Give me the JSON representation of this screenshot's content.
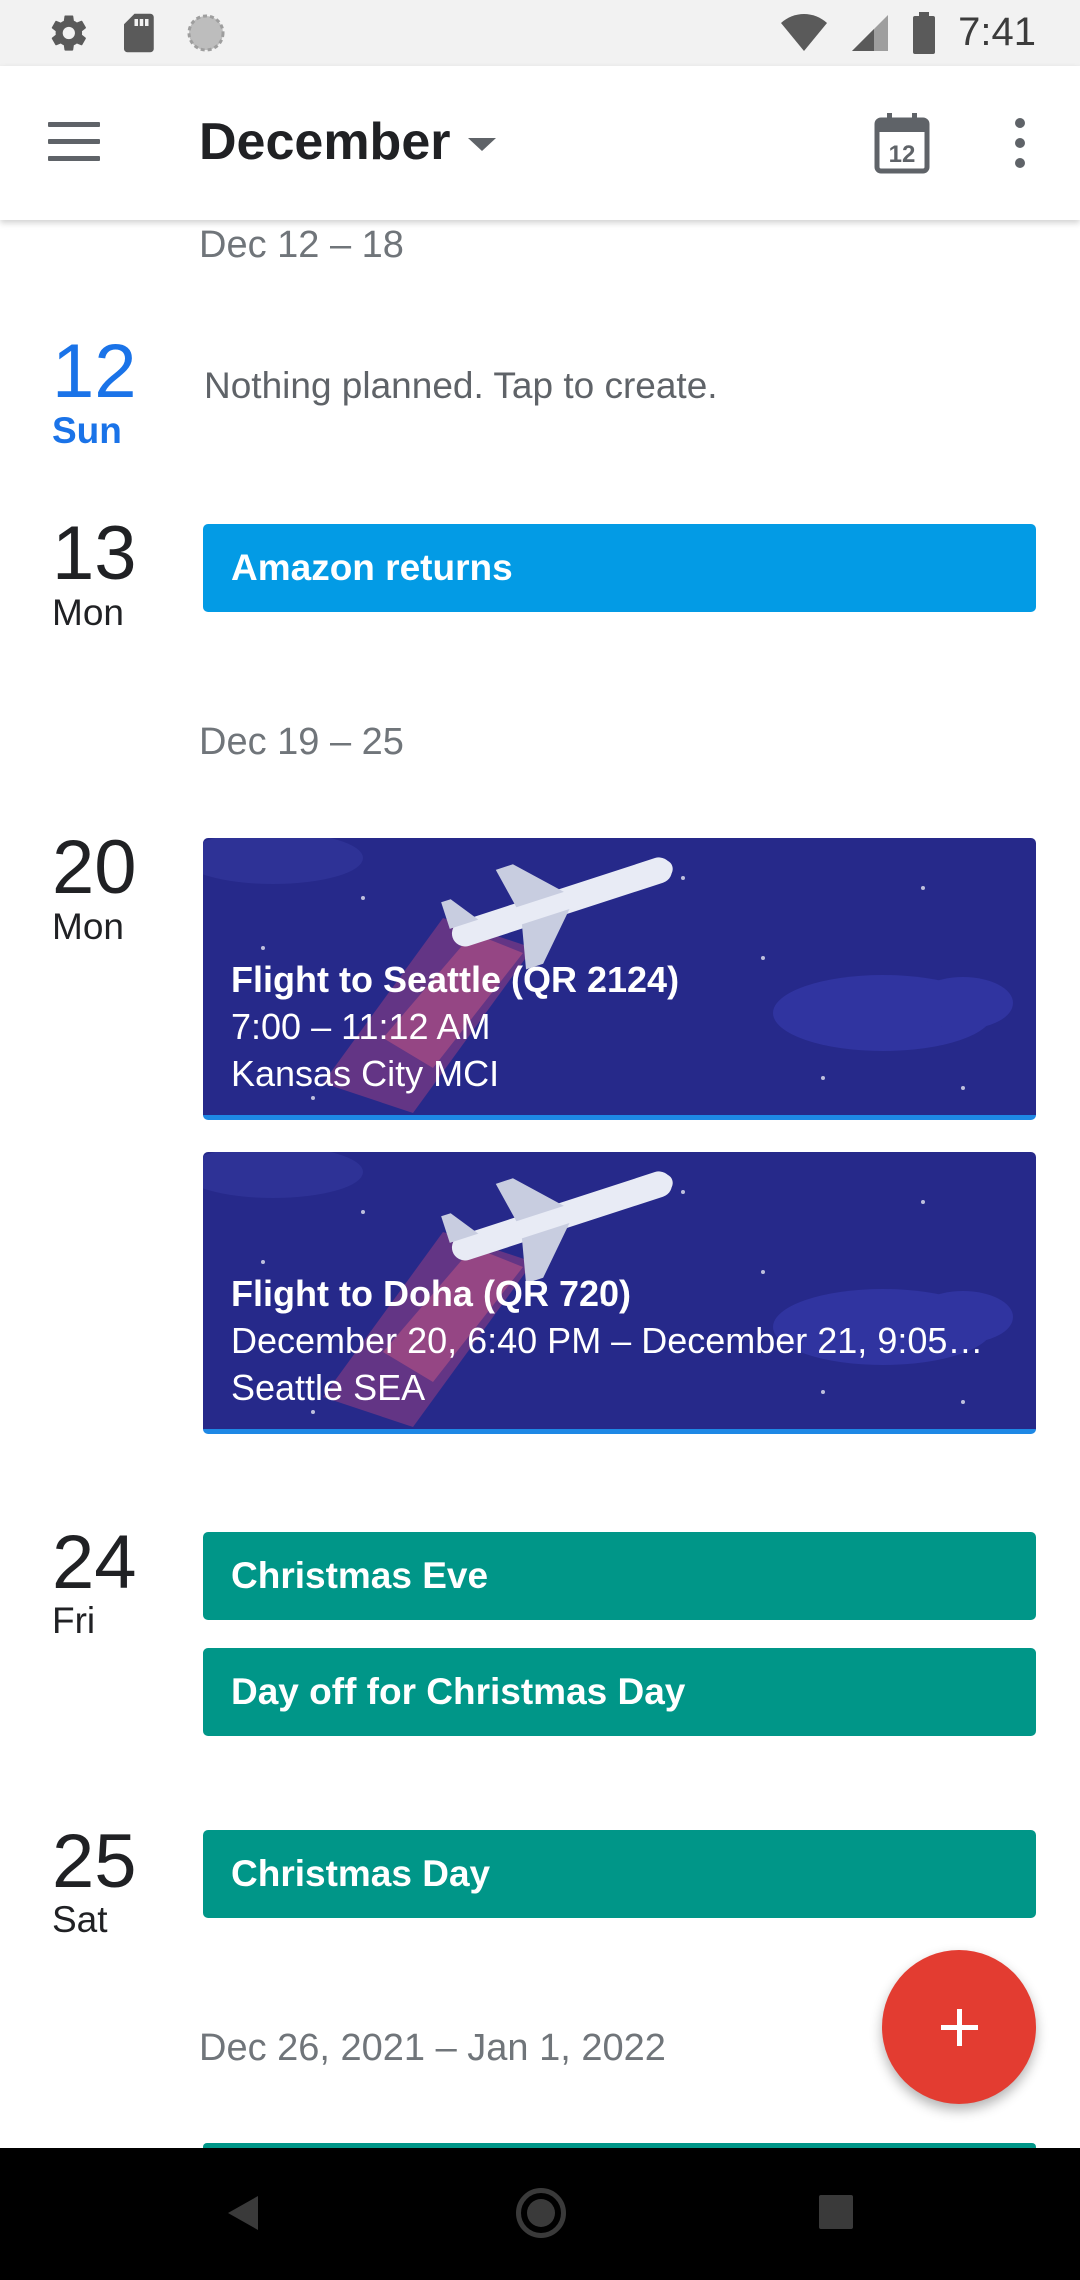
{
  "status_bar": {
    "time": "7:41",
    "left_icons": [
      "gear-icon",
      "sd-card-icon",
      "sync-icon"
    ],
    "right_icons": [
      "wifi-icon",
      "signal-icon",
      "battery-icon"
    ]
  },
  "app_bar": {
    "title": "December",
    "today_icon_day": "12"
  },
  "weeks": [
    {
      "range": "Dec 12 – 18"
    },
    {
      "range": "Dec 19 – 25"
    },
    {
      "range": "Dec 26, 2021 – Jan 1, 2022"
    }
  ],
  "days": [
    {
      "num": "12",
      "name": "Sun",
      "today": true,
      "empty_text": "Nothing planned. Tap to create."
    },
    {
      "num": "13",
      "name": "Mon",
      "events": [
        {
          "title": "Amazon returns",
          "color": "#039be5"
        }
      ]
    },
    {
      "num": "20",
      "name": "Mon",
      "events": [
        {
          "title": "Flight to Seattle (QR 2124)",
          "time": "7:00 – 11:12 AM",
          "location": "Kansas City MCI"
        },
        {
          "title": "Flight to Doha (QR 720)",
          "time": "December 20, 6:40 PM – December 21, 9:05…",
          "location": "Seattle SEA"
        }
      ]
    },
    {
      "num": "24",
      "name": "Fri",
      "events": [
        {
          "title": "Christmas Eve",
          "color": "#009688"
        },
        {
          "title": "Day off for Christmas Day",
          "color": "#009688"
        }
      ]
    },
    {
      "num": "25",
      "name": "Sat",
      "events": [
        {
          "title": "Christmas Day",
          "color": "#009688"
        }
      ]
    }
  ],
  "colors": {
    "today_accent": "#1a73e8",
    "fab": "#e33c31",
    "flight_bg": "#26298a"
  },
  "fab_icon": "plus-icon"
}
